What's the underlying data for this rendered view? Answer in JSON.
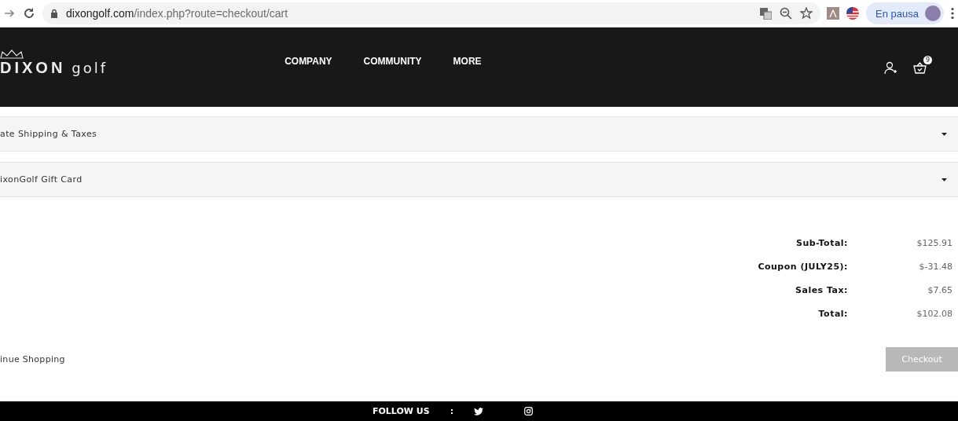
{
  "browser": {
    "url_host": "dixongolf.com",
    "url_path": "/index.php?route=checkout/cart",
    "profile_label": "En pausa"
  },
  "page": {
    "panels": [
      {
        "title": "ate Shipping & Taxes",
        "expanded": false
      },
      {
        "title": "ixonGolf Gift Card",
        "expanded": false
      }
    ],
    "totals": [
      {
        "label": "Sub-Total:",
        "value": "$125.91"
      },
      {
        "label": "Coupon (JULY25):",
        "value": "$-31.48"
      },
      {
        "label": "Sales Tax:",
        "value": "$7.65"
      },
      {
        "label": "Total:",
        "value": "$102.08"
      }
    ],
    "continue_link": "inue Shopping",
    "checkout_button": {
      "label": "Checkout",
      "disabled": true
    }
  },
  "header": {
    "logo_main": "DIXON",
    "logo_sub": "golf",
    "nav": [
      "COMPANY",
      "COMMUNITY",
      "MORE"
    ],
    "cart_count": "9"
  },
  "footer": {
    "follow_label": "FOLLOW US",
    "separator": ":"
  }
}
